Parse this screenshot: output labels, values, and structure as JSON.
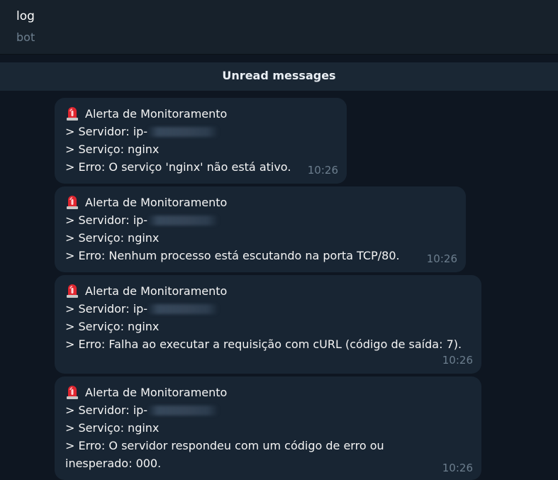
{
  "header": {
    "title": "log",
    "subtitle": "bot"
  },
  "unread_label": "Unread messages",
  "messages": [
    {
      "icon": "siren-icon",
      "title": "Alerta de Monitoramento",
      "server": "> Servidor: ip-",
      "service": "> Serviço: nginx",
      "error": "> Erro: O serviço 'nginx' não está ativo.",
      "time": "10:26"
    },
    {
      "icon": "siren-icon",
      "title": "Alerta de Monitoramento",
      "server": "> Servidor: ip-",
      "service": "> Serviço: nginx",
      "error": "> Erro: Nenhum processo está escutando na porta TCP/80.",
      "time": "10:26"
    },
    {
      "icon": "siren-icon",
      "title": "Alerta de Monitoramento",
      "server": "> Servidor: ip-",
      "service": "> Serviço: nginx",
      "error": "> Erro: Falha ao executar a requisição com cURL (código de saída: 7).",
      "time": "10:26"
    },
    {
      "icon": "siren-icon",
      "title": "Alerta de Monitoramento",
      "server": "> Servidor: ip-",
      "service": "> Serviço: nginx",
      "error": "> Erro: O servidor respondeu com um código de erro ou inesperado: 000.",
      "time": "10:26"
    }
  ]
}
